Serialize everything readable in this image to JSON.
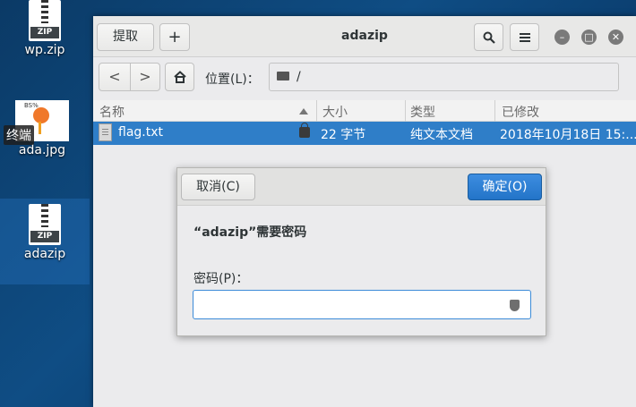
{
  "desktop": {
    "icons": [
      {
        "label": "wp.zip",
        "badge": "ZIP"
      },
      {
        "label": "ada.jpg",
        "thumb_text": "BS%"
      },
      {
        "label": "adazip",
        "badge": "ZIP"
      }
    ],
    "tooltip": "终端"
  },
  "window": {
    "title": "adazip",
    "extract_label": "提取",
    "add_label": "+",
    "search_icon": "search-icon",
    "menu_icon": "hamburger-menu-icon",
    "minimize": "–",
    "maximize": "□",
    "close": "✕",
    "back": "<",
    "forward": ">",
    "location_label": "位置(L)：",
    "location_value": "/"
  },
  "columns": [
    "名称",
    "大小",
    "类型",
    "已修改"
  ],
  "rows": [
    {
      "name": "flag.txt",
      "size": "22 字节",
      "type": "纯文本文档",
      "modified": "2018年10月18日 15:..."
    }
  ],
  "dialog": {
    "cancel_label": "取消(C)",
    "ok_label": "确定(O)",
    "title": "“adazip”需要密码",
    "password_label": "密码(P)：",
    "password_value": ""
  },
  "colors": {
    "accent": "#2f7ec8",
    "desktop_bg": "#0f4d84"
  }
}
